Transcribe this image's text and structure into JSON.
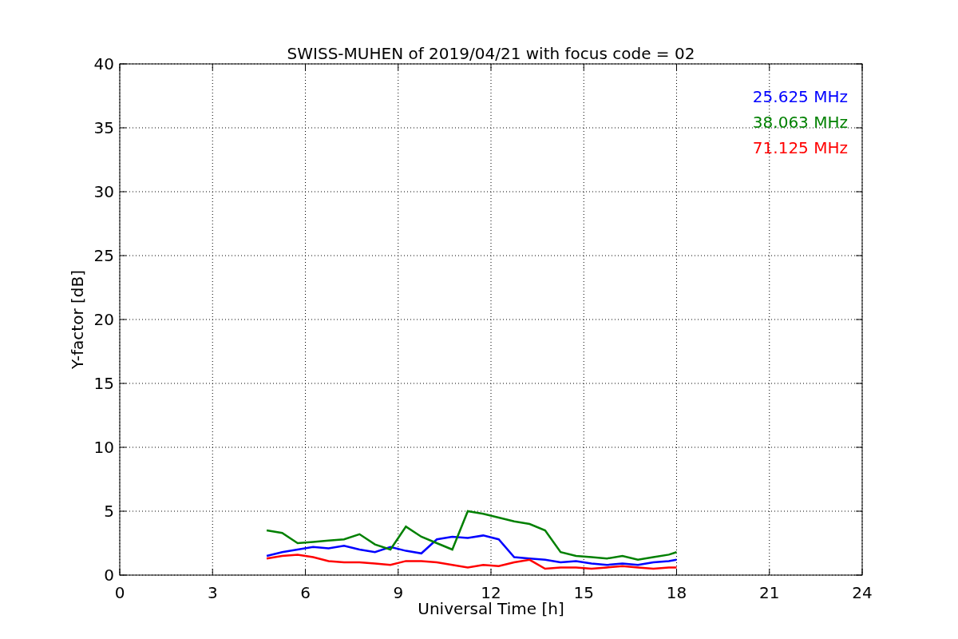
{
  "chart_data": {
    "type": "line",
    "title": "SWISS-MUHEN of 2019/04/21 with focus code = 02",
    "xlabel": "Universal Time [h]",
    "ylabel": "Y-factor [dB]",
    "x": [
      4.75,
      5.25,
      5.75,
      6.25,
      6.75,
      7.25,
      7.75,
      8.25,
      8.75,
      9.25,
      9.75,
      10.25,
      10.75,
      11.25,
      11.75,
      12.25,
      12.75,
      13.25,
      13.75,
      14.25,
      14.75,
      15.25,
      15.75,
      16.25,
      16.75,
      17.25,
      17.75,
      18
    ],
    "series": [
      {
        "name": "25.625 MHz",
        "color": "#0000ff",
        "values": [
          1.5,
          1.8,
          2.0,
          2.2,
          2.1,
          2.3,
          2.0,
          1.8,
          2.2,
          1.9,
          1.7,
          2.8,
          3.0,
          2.9,
          3.1,
          2.8,
          1.4,
          1.3,
          1.2,
          1.0,
          1.1,
          0.9,
          0.8,
          0.9,
          0.8,
          1.0,
          1.1,
          1.2
        ]
      },
      {
        "name": "38.063 MHz",
        "color": "#008000",
        "values": [
          3.5,
          3.3,
          2.5,
          2.6,
          2.7,
          2.8,
          3.2,
          2.4,
          2.0,
          3.8,
          3.0,
          2.5,
          2.0,
          5.0,
          4.8,
          4.5,
          4.2,
          4.0,
          3.5,
          1.8,
          1.5,
          1.4,
          1.3,
          1.5,
          1.2,
          1.4,
          1.6,
          1.8
        ]
      },
      {
        "name": "71.125 MHz",
        "color": "#ff0000",
        "values": [
          1.3,
          1.5,
          1.6,
          1.4,
          1.1,
          1.0,
          1.0,
          0.9,
          0.8,
          1.1,
          1.1,
          1.0,
          0.8,
          0.6,
          0.8,
          0.7,
          1.0,
          1.2,
          0.5,
          0.6,
          0.6,
          0.5,
          0.6,
          0.7,
          0.6,
          0.5,
          0.6,
          0.6
        ]
      }
    ],
    "grid": true,
    "xlim": [
      0,
      24
    ],
    "ylim": [
      0,
      40
    ],
    "xticks": [
      0,
      3,
      6,
      9,
      12,
      15,
      18,
      21,
      24
    ],
    "yticks": [
      0,
      5,
      10,
      15,
      20,
      25,
      30,
      35,
      40
    ]
  }
}
